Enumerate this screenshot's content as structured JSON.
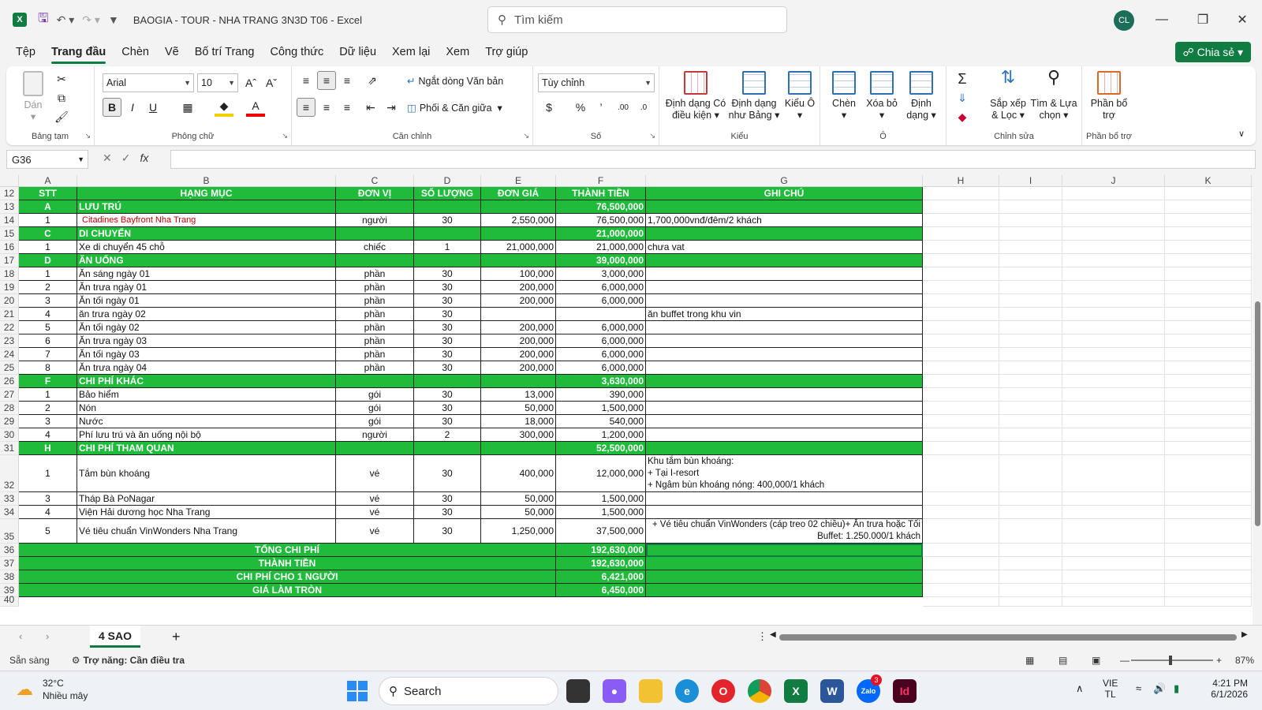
{
  "window": {
    "title": "BAOGIA - TOUR - NHA TRANG 3N3D T06  -  Excel",
    "search_placeholder": "Tìm kiếm",
    "avatar": "CL"
  },
  "menu": [
    "Tệp",
    "Trang đầu",
    "Chèn",
    "Vẽ",
    "Bố trí Trang",
    "Công thức",
    "Dữ liệu",
    "Xem lại",
    "Xem",
    "Trợ giúp"
  ],
  "share_label": "Chia sẻ",
  "ribbon": {
    "paste": "Dán",
    "clipboard": "Bảng tạm",
    "font_name": "Arial",
    "font_size": "10",
    "font_group": "Phông chữ",
    "wrap_text": "Ngắt dòng Văn bản",
    "merge_center": "Phối & Căn giữa",
    "alignment_group": "Căn chỉnh",
    "number_format": "Tùy chỉnh",
    "number_group": "Số",
    "cond_format": "Định dạng Có điều kiện",
    "format_table": "Định dạng như Bảng",
    "cell_styles": "Kiểu Ô",
    "styles_group": "Kiểu",
    "insert": "Chèn",
    "delete": "Xóa bỏ",
    "format": "Định dạng",
    "cells_group": "Ô",
    "sort_filter": "Sắp xếp & Lọc",
    "find_select": "Tìm & Lựa chọn",
    "editing_group": "Chỉnh sửa",
    "addins": "Phần bổ trợ",
    "addins_group": "Phần bổ trợ"
  },
  "name_box": "G36",
  "columns": [
    "A",
    "B",
    "C",
    "D",
    "E",
    "F",
    "G",
    "H",
    "I",
    "J",
    "K"
  ],
  "rows": [
    {
      "n": "12",
      "g": true,
      "cells": [
        "STT",
        "HẠNG MỤC",
        "ĐƠN VỊ",
        "SỐ LƯỢNG",
        "ĐƠN GIÁ",
        "THÀNH TIỀN",
        "GHI CHÚ"
      ]
    },
    {
      "n": "13",
      "g": true,
      "cells": [
        "A",
        "LƯU TRÚ",
        "",
        "",
        "",
        "76,500,000",
        ""
      ]
    },
    {
      "n": "14",
      "cells": [
        "1",
        "Citadines Bayfront Nha Trang",
        "người",
        "30",
        "2,550,000",
        "76,500,000",
        "1,700,000vnđ/đêm/2 khách"
      ]
    },
    {
      "n": "15",
      "g": true,
      "cells": [
        "C",
        "DI CHUYỂN",
        "",
        "",
        "",
        "21,000,000",
        ""
      ]
    },
    {
      "n": "16",
      "cells": [
        "1",
        "Xe di chuyển 45 chỗ",
        "chiếc",
        "1",
        "21,000,000",
        "21,000,000",
        "chưa vat"
      ]
    },
    {
      "n": "17",
      "g": true,
      "cells": [
        "D",
        "ĂN UỐNG",
        "",
        "",
        "",
        "39,000,000",
        ""
      ]
    },
    {
      "n": "18",
      "cells": [
        "1",
        "Ăn sáng ngày 01",
        "phần",
        "30",
        "100,000",
        "3,000,000",
        ""
      ]
    },
    {
      "n": "19",
      "cells": [
        "2",
        "Ăn trưa ngày 01",
        "phần",
        "30",
        "200,000",
        "6,000,000",
        ""
      ]
    },
    {
      "n": "20",
      "cells": [
        "3",
        "Ăn tối ngày 01",
        "phần",
        "30",
        "200,000",
        "6,000,000",
        ""
      ]
    },
    {
      "n": "21",
      "cells": [
        "4",
        "ăn trưa ngày  02",
        "phần",
        "30",
        "",
        "",
        "ăn buffet trong khu vin"
      ]
    },
    {
      "n": "22",
      "cells": [
        "5",
        "Ăn tối ngày 02",
        "phần",
        "30",
        "200,000",
        "6,000,000",
        ""
      ]
    },
    {
      "n": "23",
      "cells": [
        "6",
        "Ăn trưa ngày 03",
        "phần",
        "30",
        "200,000",
        "6,000,000",
        ""
      ]
    },
    {
      "n": "24",
      "cells": [
        "7",
        "Ăn tối ngày 03",
        "phần",
        "30",
        "200,000",
        "6,000,000",
        ""
      ]
    },
    {
      "n": "25",
      "cells": [
        "8",
        "Ăn trưa ngày 04",
        "phần",
        "30",
        "200,000",
        "6,000,000",
        ""
      ]
    },
    {
      "n": "26",
      "g": true,
      "cells": [
        "F",
        "CHI PHÍ KHÁC",
        "",
        "",
        "",
        "3,630,000",
        ""
      ]
    },
    {
      "n": "27",
      "cells": [
        "1",
        "Bảo hiểm",
        "gói",
        "30",
        "13,000",
        "390,000",
        ""
      ]
    },
    {
      "n": "28",
      "cells": [
        "2",
        "Nón",
        "gói",
        "30",
        "50,000",
        "1,500,000",
        ""
      ]
    },
    {
      "n": "29",
      "cells": [
        "3",
        "Nước",
        "gói",
        "30",
        "18,000",
        "540,000",
        ""
      ]
    },
    {
      "n": "30",
      "cells": [
        "4",
        "Phí lưu trú và ăn uống nội bộ",
        "người",
        "2",
        "300,000",
        "1,200,000",
        ""
      ]
    },
    {
      "n": "31",
      "g": true,
      "cells": [
        "H",
        "CHI PHÍ THAM QUAN",
        "",
        "",
        "",
        "52,500,000",
        ""
      ]
    },
    {
      "n": "32",
      "cells": [
        "1",
        "Tắm bùn khoáng",
        "vé",
        "30",
        "400,000",
        "12,000,000",
        "Khu tắm bùn khoáng:\n+ Tại I-resort\n+ Ngâm bùn khoáng nóng: 400,000/1 khách"
      ]
    },
    {
      "n": "33",
      "cells": [
        "3",
        "Tháp Bà PoNagar",
        "vé",
        "30",
        "50,000",
        "1,500,000",
        ""
      ]
    },
    {
      "n": "34",
      "cells": [
        "4",
        "Viện Hải dương học Nha Trang",
        "vé",
        "30",
        "50,000",
        "1,500,000",
        ""
      ]
    },
    {
      "n": "35",
      "cells": [
        "5",
        "Vé tiêu chuẩn VinWonders Nha Trang",
        "vé",
        "30",
        "1,250,000",
        "37,500,000",
        "+ Vé tiêu chuẩn VinWonders (cáp treo 02 chiều)+ Ăn trưa hoặc Tối  Buffet: 1.250.000/1 khách"
      ]
    },
    {
      "n": "36",
      "sum": true,
      "cells": [
        "TỔNG CHI PHÍ",
        "192,630,000"
      ]
    },
    {
      "n": "37",
      "sum": true,
      "cells": [
        "THÀNH TIỀN",
        "192,630,000"
      ]
    },
    {
      "n": "38",
      "sum": true,
      "cells": [
        "CHI PHÍ CHO 1 NGƯỜI",
        "6,421,000"
      ]
    },
    {
      "n": "39",
      "sum": true,
      "cells": [
        "GIÁ LÀM TRÒN",
        "6,450,000"
      ]
    },
    {
      "n": "40",
      "empty": true,
      "cells": []
    }
  ],
  "sheet_tab": "4 SAO",
  "status": {
    "ready": "Sẵn sàng",
    "accessibility": "Trợ năng: Cần điều tra",
    "zoom": "87%"
  },
  "taskbar": {
    "temp": "32°C",
    "weather": "Nhiều mây",
    "search": "Search",
    "lang1": "VIE",
    "lang2": "TL",
    "time": "4:21 PM",
    "date": "6/1/2026",
    "badge": "3"
  }
}
